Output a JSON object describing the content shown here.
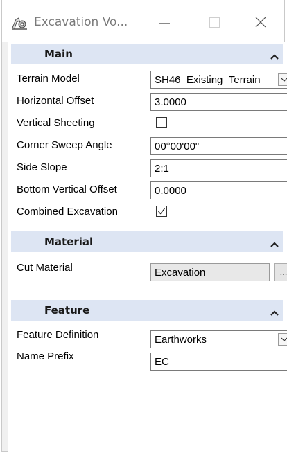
{
  "window": {
    "title": "Excavation Vo...",
    "app_icon": "excavation-tool-icon",
    "controls": [
      "minimize-icon",
      "maximize-icon",
      "close-icon"
    ]
  },
  "sections": {
    "main": {
      "title": "Main",
      "collapse_icon": "chevron-up-icon",
      "terrain_model": {
        "label": "Terrain Model",
        "value": "SH46_Existing_Terrain"
      },
      "horizontal_offset": {
        "label": "Horizontal Offset",
        "value": "3.0000"
      },
      "vertical_sheeting": {
        "label": "Vertical Sheeting",
        "checked": false
      },
      "corner_sweep_angle": {
        "label": "Corner Sweep Angle",
        "value": "00°00'00\""
      },
      "side_slope": {
        "label": "Side Slope",
        "value": "2:1"
      },
      "bottom_vertical_offset": {
        "label": "Bottom Vertical Offset",
        "value": "0.0000"
      },
      "combined_excavation": {
        "label": "Combined Excavation",
        "checked": true
      }
    },
    "material": {
      "title": "Material",
      "collapse_icon": "chevron-up-icon",
      "cut_material": {
        "label": "Cut Material",
        "value": "Excavation",
        "button_label": "..."
      }
    },
    "feature": {
      "title": "Feature",
      "collapse_icon": "chevron-up-icon",
      "feature_definition": {
        "label": "Feature Definition",
        "value": "Earthworks"
      },
      "name_prefix": {
        "label": "Name Prefix",
        "value": "EC"
      }
    }
  },
  "colors": {
    "section_header_bg": "#dde5f3",
    "panel_bg": "#ffffff",
    "window_bg": "#f0f0f0",
    "title_text": "#7a7a7a"
  }
}
